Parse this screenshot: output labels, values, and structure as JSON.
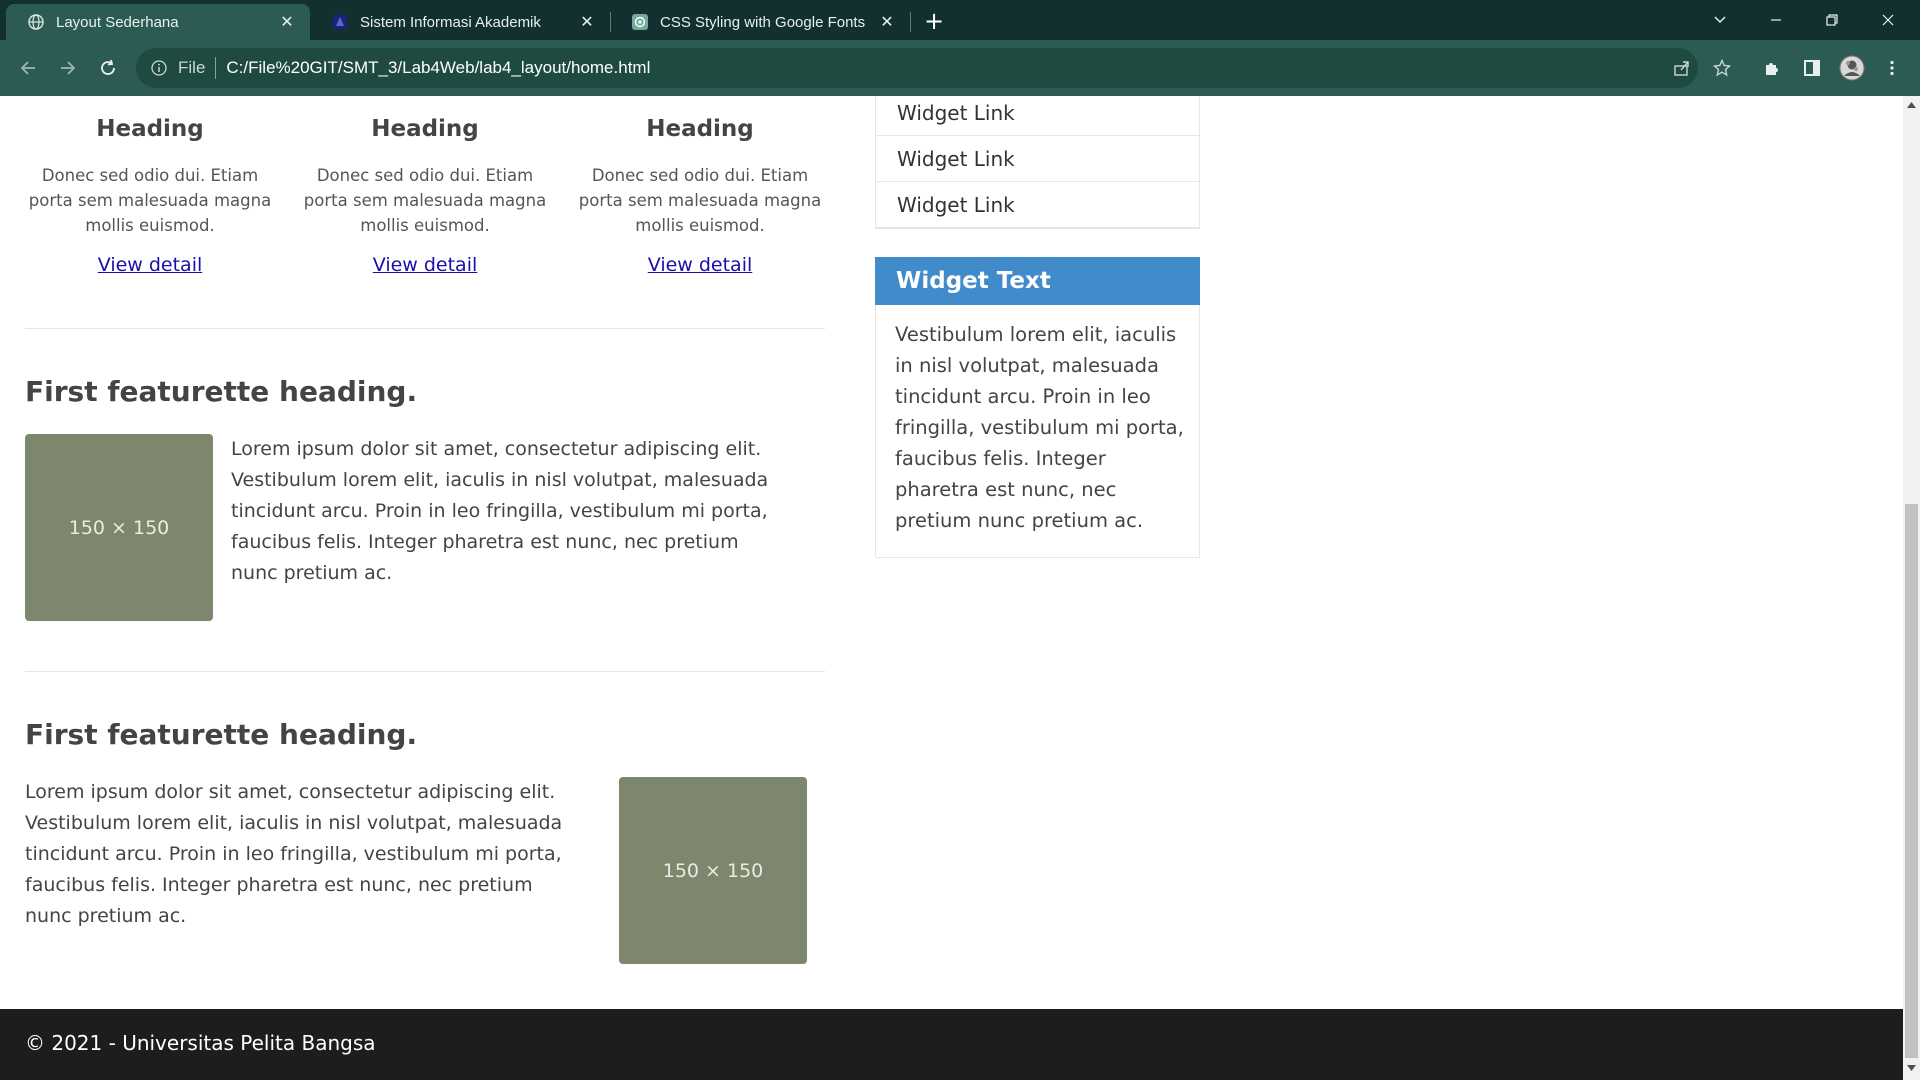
{
  "browser": {
    "tabs": [
      {
        "label": "Layout Sederhana",
        "icon": "globe-icon"
      },
      {
        "label": "Sistem Informasi Akademik",
        "icon": "site-favicon"
      },
      {
        "label": "CSS Styling with Google Fonts",
        "icon": "openai-icon"
      }
    ],
    "address": {
      "scheme": "File",
      "url": "C:/File%20GIT/SMT_3/Lab4Web/lab4_layout/home.html"
    }
  },
  "page": {
    "columns": [
      {
        "heading": "Heading",
        "text": "Donec sed odio dui. Etiam porta sem malesuada magna mollis euismod.",
        "link": "View detail",
        "color": "#e08a1e"
      },
      {
        "heading": "Heading",
        "text": "Donec sed odio dui. Etiam porta sem malesuada magna mollis euismod.",
        "link": "View detail",
        "color": "#3a78c4"
      },
      {
        "heading": "Heading",
        "text": "Donec sed odio dui. Etiam porta sem malesuada magna mollis euismod.",
        "link": "View detail",
        "color": "#3fc6a8"
      }
    ],
    "featurettes": [
      {
        "heading": "First featurette heading.",
        "text": "Lorem ipsum dolor sit amet, consectetur adipiscing elit. Vestibulum lorem elit, iaculis in nisl volutpat, malesuada tincidunt arcu. Proin in leo fringilla, vestibulum mi porta, faucibus felis. Integer pharetra est nunc, nec pretium nunc pretium ac.",
        "image_label": "150 × 150"
      },
      {
        "heading": "First featurette heading.",
        "text": "Lorem ipsum dolor sit amet, consectetur adipiscing elit. Vestibulum lorem elit, iaculis in nisl volutpat, malesuada tincidunt arcu. Proin in leo fringilla, vestibulum mi porta, faucibus felis. Integer pharetra est nunc, nec pretium nunc pretium ac.",
        "image_label": "150 × 150"
      }
    ],
    "sidebar": {
      "links": [
        "Widget Link",
        "Widget Link",
        "Widget Link"
      ],
      "widget_title": "Widget Text",
      "widget_text": "Vestibulum lorem elit, iaculis in nisl volutpat, malesuada tincidunt arcu. Proin in leo fringilla, vestibulum mi porta, faucibus felis. Integer pharetra est nunc, nec pretium nunc pretium ac."
    },
    "footer": "© 2021 - Universitas Pelita Bangsa"
  },
  "colors": {
    "tabbar": "#12302f",
    "toolbar": "#2b5b52",
    "widget_header": "#428bca",
    "placeholder": "#7c876e",
    "footer": "#1d1d1d"
  }
}
